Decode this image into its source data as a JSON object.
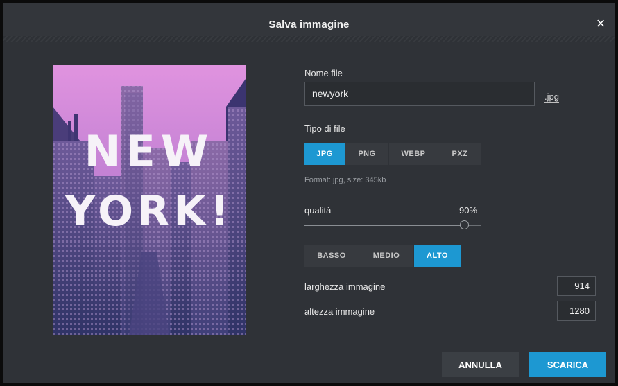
{
  "dialog": {
    "title": "Salva immagine",
    "close_glyph": "×"
  },
  "preview": {
    "overlay_text": [
      "NEW",
      "YORK!"
    ]
  },
  "filename": {
    "label": "Nome file",
    "value": "newyork",
    "extension": ".jpg"
  },
  "filetype": {
    "label": "Tipo di file",
    "options": [
      "JPG",
      "PNG",
      "WEBP",
      "PXZ"
    ],
    "selected": "JPG",
    "info": "Format: jpg, size: 345kb"
  },
  "quality": {
    "label": "qualità",
    "value_text": "90%",
    "value": 0.9,
    "presets": [
      "BASSO",
      "MEDIO",
      "ALTO"
    ],
    "selected_preset": "ALTO"
  },
  "dimensions": {
    "width_label": "larghezza immagine",
    "width_value": "914",
    "height_label": "altezza immagine",
    "height_value": "1280"
  },
  "actions": {
    "cancel": "ANNULLA",
    "download": "SCARICA"
  },
  "colors": {
    "accent": "#1d98d2",
    "panel": "#2f3237",
    "preview_sky": "#d88ad6"
  }
}
